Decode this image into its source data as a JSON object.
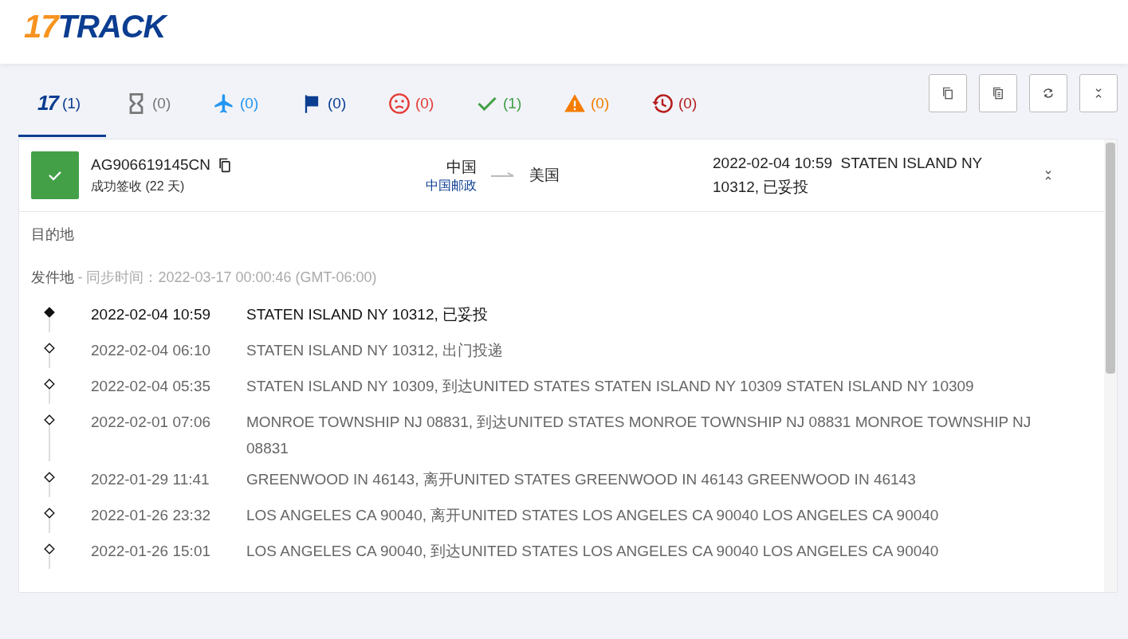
{
  "logo": {
    "accent": "17",
    "main": "TRACK"
  },
  "tabs": [
    {
      "kind": "all",
      "icon_text": "17",
      "count": "(1)",
      "color": "#0b3d91",
      "selected": true
    },
    {
      "kind": "pending",
      "count": "(0)",
      "color": "#777777",
      "selected": false
    },
    {
      "kind": "transit",
      "count": "(0)",
      "color": "#2196f3",
      "selected": false
    },
    {
      "kind": "pickup",
      "count": "(0)",
      "color": "#0b3d91",
      "selected": false
    },
    {
      "kind": "undelivered",
      "count": "(0)",
      "color": "#e53935",
      "selected": false
    },
    {
      "kind": "delivered",
      "count": "(1)",
      "color": "#43a047",
      "selected": false
    },
    {
      "kind": "alert",
      "count": "(0)",
      "color": "#f57c00",
      "selected": false
    },
    {
      "kind": "expired",
      "count": "(0)",
      "color": "#b71c1c",
      "selected": false
    }
  ],
  "toolbar": [
    {
      "kind": "copy"
    },
    {
      "kind": "list"
    },
    {
      "kind": "refresh"
    },
    {
      "kind": "collapse"
    }
  ],
  "shipment": {
    "number": "AG906619145CN",
    "status": "成功签收 (22 天)",
    "origin": "中国",
    "carrier": "中国邮政",
    "destination": "美国",
    "latest_time": "2022-02-04 10:59",
    "latest_event": "STATEN ISLAND NY 10312, 已妥投"
  },
  "destination_section": {
    "title": "目的地"
  },
  "origin_section": {
    "title": "发件地",
    "sync": "- 同步时间：2022-03-17 00:00:46 (GMT-06:00)"
  },
  "events": [
    {
      "time": "2022-02-04 10:59",
      "text": "STATEN ISLAND NY 10312, 已妥投",
      "current": true
    },
    {
      "time": "2022-02-04 06:10",
      "text": "STATEN ISLAND NY 10312, 出门投递",
      "current": false
    },
    {
      "time": "2022-02-04 05:35",
      "text": "STATEN ISLAND NY 10309, 到达UNITED STATES STATEN ISLAND NY 10309 STATEN ISLAND NY 10309",
      "current": false
    },
    {
      "time": "2022-02-01 07:06",
      "text": "MONROE TOWNSHIP NJ 08831, 到达UNITED STATES MONROE TOWNSHIP NJ 08831 MONROE TOWNSHIP NJ 08831",
      "current": false
    },
    {
      "time": "2022-01-29 11:41",
      "text": "GREENWOOD IN 46143, 离开UNITED STATES GREENWOOD IN 46143 GREENWOOD IN 46143",
      "current": false
    },
    {
      "time": "2022-01-26 23:32",
      "text": "LOS ANGELES CA 90040, 离开UNITED STATES LOS ANGELES CA 90040 LOS ANGELES CA 90040",
      "current": false
    },
    {
      "time": "2022-01-26 15:01",
      "text": "LOS ANGELES CA 90040, 到达UNITED STATES LOS ANGELES CA 90040 LOS ANGELES CA 90040",
      "current": false
    }
  ]
}
